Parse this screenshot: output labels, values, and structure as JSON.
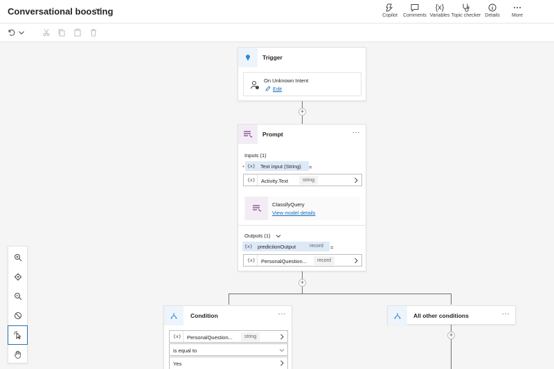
{
  "header": {
    "title": "Conversational boosting",
    "buttons": [
      {
        "label": "Copilot",
        "icon": "copilot-icon"
      },
      {
        "label": "Comments",
        "icon": "comment-icon"
      },
      {
        "label": "Variables",
        "icon": "variables-icon"
      },
      {
        "label": "Topic checker",
        "icon": "stethoscope-icon"
      },
      {
        "label": "Details",
        "icon": "info-icon"
      },
      {
        "label": "More",
        "icon": "more-icon"
      }
    ]
  },
  "toolbar": {
    "icons": [
      "undo-icon",
      "chevron-down-icon",
      "cut-icon",
      "copy-icon",
      "paste-icon",
      "delete-icon"
    ]
  },
  "trigger": {
    "title": "Trigger",
    "intent": "On Unknown Intent",
    "edit": "Edit"
  },
  "prompt": {
    "title": "Prompt",
    "more": "···",
    "inputs_label": "Inputs (1)",
    "required_mark": "*",
    "input_var": "Text input (String)",
    "equals": "=",
    "input_value": "Activity.Text",
    "input_type": "string",
    "model_name": "ClassifyQuery",
    "model_link": "View model details",
    "outputs_label": "Outputs (1)",
    "output_var": "predictionOutput",
    "output_var_type": "record",
    "output_value": "PersonalQuestion...",
    "output_type": "record"
  },
  "condition": {
    "title": "Condition",
    "more": "···",
    "var": "PersonalQuestion...",
    "var_type": "string",
    "operator": "is equal to",
    "value": "Yes"
  },
  "other": {
    "title": "All other conditions",
    "more": "···"
  },
  "var_glyph": "{x}",
  "plus_glyph": "+",
  "colors": {
    "accent": "#0f6cbd",
    "chip": "#dde9f7",
    "icon_bg": "#eef4fb",
    "prompt_icon_bg": "#f3ecf5"
  }
}
